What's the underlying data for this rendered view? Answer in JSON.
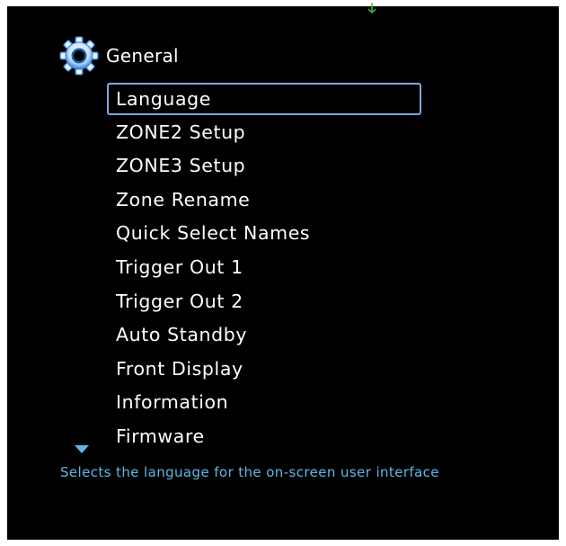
{
  "header": {
    "icon": "gear-icon",
    "title": "General"
  },
  "menu": {
    "items": [
      {
        "label": "Language",
        "selected": true
      },
      {
        "label": "ZONE2 Setup"
      },
      {
        "label": "ZONE3 Setup"
      },
      {
        "label": "Zone Rename"
      },
      {
        "label": "Quick Select Names"
      },
      {
        "label": "Trigger Out 1"
      },
      {
        "label": "Trigger Out 2"
      },
      {
        "label": "Auto Standby"
      },
      {
        "label": "Front Display"
      },
      {
        "label": "Information"
      },
      {
        "label": "Firmware"
      }
    ],
    "scroll_indicator": "chevron-down-icon"
  },
  "help": {
    "text": "Selects the language for the on-screen user interface"
  },
  "colors": {
    "background": "#000000",
    "text": "#ffffff",
    "help_text": "#5db8e6",
    "selection_border": "#7fa8d8",
    "gear_fill": "#cfe3ff",
    "gear_accent": "#2f7fd8",
    "top_marker": "#3fbf3f"
  }
}
